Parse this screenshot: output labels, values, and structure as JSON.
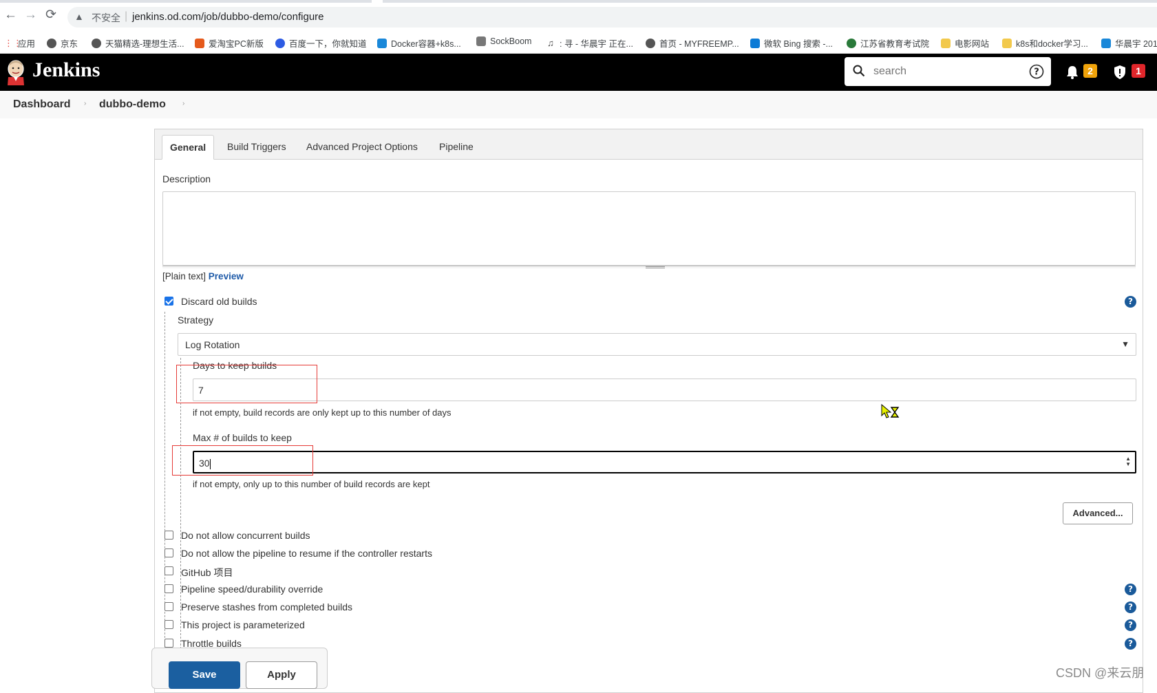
{
  "browser": {
    "back": "←",
    "forward": "→",
    "reload": "⟳",
    "insecure_label": "不安全",
    "url": "jenkins.od.com/job/dubbo-demo/configure"
  },
  "bookmarks": [
    {
      "label": "应用",
      "color": "#e8453c"
    },
    {
      "label": "京东",
      "color": "#555"
    },
    {
      "label": "天猫精选-理想生活...",
      "color": "#555"
    },
    {
      "label": "爱淘宝PC新版",
      "color": "#e55a1c"
    },
    {
      "label": "百度一下，你就知道",
      "color": "#2d5be3"
    },
    {
      "label": "Docker容器+k8s...",
      "color": "#1a88d9"
    },
    {
      "label": "SockBoom",
      "color": "#666"
    },
    {
      "label": ": 寻 - 华晨宇 正在...",
      "color": "#444"
    },
    {
      "label": "首页 - MYFREEMP...",
      "color": "#555"
    },
    {
      "label": "微软 Bing 搜索 -...",
      "color": "#0c7bd6"
    },
    {
      "label": "江苏省教育考试院",
      "color": "#2a7a3a"
    },
    {
      "label": "电影网站",
      "color": "#f2c94c"
    },
    {
      "label": "k8s和docker学习...",
      "color": "#f2c94c"
    },
    {
      "label": "华晨宇 201",
      "color": "#1a88d9"
    }
  ],
  "header": {
    "title": "Jenkins",
    "search_placeholder": "search",
    "notifications_count": "2",
    "security_count": "1"
  },
  "breadcrumb": {
    "items": [
      "Dashboard",
      "dubbo-demo"
    ]
  },
  "tabs": [
    "General",
    "Build Triggers",
    "Advanced Project Options",
    "Pipeline"
  ],
  "general": {
    "description_label": "Description",
    "plain_text": "[Plain text]",
    "preview": "Preview",
    "discard_label": "Discard old builds",
    "strategy_label": "Strategy",
    "strategy_value": "Log Rotation",
    "days_label": "Days to keep builds",
    "days_value": "7",
    "days_hint": "if not empty, build records are only kept up to this number of days",
    "max_label": "Max # of builds to keep",
    "max_value": "30",
    "max_hint": "if not empty, only up to this number of build records are kept",
    "advanced_label": "Advanced...",
    "options": [
      {
        "label": "Do not allow concurrent builds",
        "checked": false,
        "help": false
      },
      {
        "label": "Do not allow the pipeline to resume if the controller restarts",
        "checked": false,
        "help": false
      },
      {
        "label": "GitHub 项目",
        "checked": false,
        "help": false
      },
      {
        "label": "Pipeline speed/durability override",
        "checked": false,
        "help": true
      },
      {
        "label": "Preserve stashes from completed builds",
        "checked": false,
        "help": true
      },
      {
        "label": "This project is parameterized",
        "checked": false,
        "help": true
      },
      {
        "label": "Throttle builds",
        "checked": false,
        "help": true
      }
    ]
  },
  "actions": {
    "save": "Save",
    "apply": "Apply"
  },
  "watermark": "CSDN @来云朋"
}
